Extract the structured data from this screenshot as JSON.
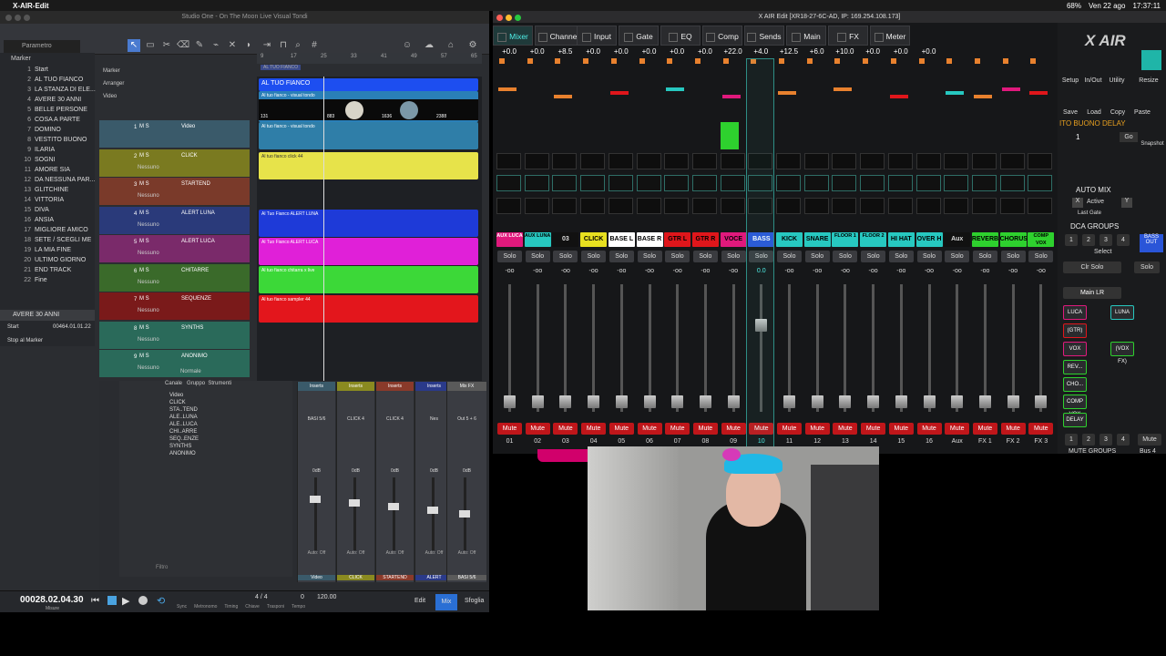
{
  "menubar": {
    "app": "X-AIR-Edit",
    "date": "Ven 22 ago",
    "time": "17:37:11",
    "battery": "68%"
  },
  "studio": {
    "title": "Studio One - On The Moon Live Visual Tondi",
    "param_label": "Parametro",
    "markers_header": "Marker",
    "markers": [
      {
        "n": "1",
        "name": "Start"
      },
      {
        "n": "2",
        "name": "AL TUO FIANCO"
      },
      {
        "n": "3",
        "name": "LA STANZA DI ELE..."
      },
      {
        "n": "4",
        "name": "AVERE 30 ANNI"
      },
      {
        "n": "5",
        "name": "BELLE PERSONE"
      },
      {
        "n": "6",
        "name": "COSA A PARTE"
      },
      {
        "n": "7",
        "name": "DOMINO"
      },
      {
        "n": "8",
        "name": "VESTITO BUONO"
      },
      {
        "n": "9",
        "name": "ILARIA"
      },
      {
        "n": "10",
        "name": "SOGNI"
      },
      {
        "n": "11",
        "name": "AMORE SIA"
      },
      {
        "n": "12",
        "name": "DA NESSUNA PAR..."
      },
      {
        "n": "13",
        "name": "GLITCHINE"
      },
      {
        "n": "14",
        "name": "VITTORIA"
      },
      {
        "n": "15",
        "name": "DIVA"
      },
      {
        "n": "16",
        "name": "ANSIA"
      },
      {
        "n": "17",
        "name": "MIGLIORE AMICO"
      },
      {
        "n": "18",
        "name": "SETE / SCEGLI ME"
      },
      {
        "n": "19",
        "name": "LA MIA FINE"
      },
      {
        "n": "20",
        "name": "ULTIMO GIORNO"
      },
      {
        "n": "21",
        "name": "END TRACK"
      },
      {
        "n": "22",
        "name": "Fine"
      }
    ],
    "marker_current": "AVERE 30 ANNI",
    "marker_start": "Start",
    "marker_start_time": "00464.01.01.22",
    "stop_at_marker": "Stop al Marker",
    "arranger_label": "Arranger",
    "video_label": "Video",
    "marker_row_label": "Marker",
    "ruler_marks": [
      "9",
      "17",
      "25",
      "33",
      "41",
      "49",
      "57",
      "65"
    ],
    "ruler_marker_tag": "AL TUO FIANCO",
    "tracks": [
      {
        "num": "1",
        "name": "Video",
        "sub": "",
        "color": "#3a5a6a"
      },
      {
        "num": "2",
        "name": "CLICK",
        "sub": "Nessuno",
        "color": "#7a7a20"
      },
      {
        "num": "3",
        "name": "STARTEND",
        "sub": "Nessuno",
        "color": "#7a3a2a"
      },
      {
        "num": "4",
        "name": "ALERT LUNA",
        "sub": "Nessuno",
        "color": "#2a3a7a"
      },
      {
        "num": "5",
        "name": "ALERT LUCA",
        "sub": "Nessuno",
        "color": "#7a2a6a"
      },
      {
        "num": "6",
        "name": "CHITARRE",
        "sub": "Nessuno",
        "color": "#3a6a2a"
      },
      {
        "num": "7",
        "name": "SEQUENZE",
        "sub": "Nessuno",
        "color": "#7a1a1a"
      },
      {
        "num": "8",
        "name": "SYNTHS",
        "sub": "Nessuno",
        "color": "#2a6a5a"
      },
      {
        "num": "9",
        "name": "ANONIMO",
        "sub": "Nessuno",
        "color": "#2a6a5a"
      }
    ],
    "clips": {
      "arranger": "AL TUO FIANCO",
      "video": "Al tuo fianco - visual tondo",
      "video_frames": [
        "131",
        "883",
        "1636",
        "2388"
      ],
      "video_audio": "Al tuo fianco - visual tondo",
      "click": "Al tuo fianco click 44",
      "luna": "Al Tuo Fianco ALERT LUNA",
      "luca": "Al Tuo Fianco ALERT LUCA",
      "chitarre": "Al tuo fianco chitarra x live",
      "sequenze": "Al tuo fianco sampler 44"
    },
    "normal_label": "Normale",
    "console": {
      "tabs": [
        "Canale",
        "Gruppo",
        "Strumenti"
      ],
      "channels": [
        "Video",
        "CLICK",
        "STA..TEND",
        "ALE..LUNA",
        "ALE..LUCA",
        "CHI..ARRE",
        "SEQ..ENZE",
        "SYNTHS",
        "ANONIMO"
      ],
      "filter": "Filtro",
      "inserts_label": "Inserts",
      "strips": [
        {
          "label": "Video",
          "in": "BASI 5/6",
          "num": "1"
        },
        {
          "label": "CLICK",
          "in": "CLICK 4",
          "num": "2"
        },
        {
          "label": "STARTEND",
          "in": "CLICK 4",
          "num": "3"
        },
        {
          "label": "ALERT",
          "in": "Nes",
          "num": "4"
        },
        {
          "label": "BASI 5/6",
          "in": "Out 5 + 6",
          "num": ""
        }
      ],
      "mix_fx": "Mix FX",
      "stereo": "Stereo",
      "nessuno": "Nessuno",
      "auto_off": "Auto: Off",
      "db_label": "0dB"
    },
    "transport": {
      "time": "00028.02.04.30",
      "time_unit": "Misure",
      "sig": "4 / 4",
      "key": "0",
      "tempo": "120.00",
      "labels": [
        "Sync",
        "Metronomo",
        "Timing",
        "Chiave",
        "Trasponi",
        "Tempo"
      ],
      "edit": "Edit",
      "mix": "Mix",
      "browse": "Sfoglia"
    }
  },
  "xair": {
    "title": "X AIR Edit [XR18-27-6C-AD, IP: 169.254.108.173]",
    "tabs": [
      "Mixer",
      "Channel",
      "Input",
      "Gate",
      "EQ",
      "Comp",
      "Sends",
      "Main",
      "FX",
      "Meter"
    ],
    "active_tab": "Mixer",
    "logo": "X AIR",
    "gains": [
      "+0.0",
      "+0.0",
      "+8.5",
      "+0.0",
      "+0.0",
      "+0.0",
      "+0.0",
      "+0.0",
      "+22.0",
      "+4.0",
      "+12.5",
      "+6.0",
      "+10.0",
      "+0.0",
      "+0.0",
      "+0.0"
    ],
    "channels": [
      {
        "name": "AUX LUCA",
        "color": "#e0197c",
        "fcolor": "#fff",
        "num": "01"
      },
      {
        "name": "AUX LUNA",
        "color": "#27c8c0",
        "fcolor": "#000",
        "num": "02"
      },
      {
        "name": "03",
        "color": "#111",
        "fcolor": "#ddd",
        "num": "03"
      },
      {
        "name": "CLICK",
        "color": "#e8e020",
        "fcolor": "#000",
        "num": "04"
      },
      {
        "name": "BASE L",
        "color": "#ffffff",
        "fcolor": "#000",
        "num": "05"
      },
      {
        "name": "BASE R",
        "color": "#ffffff",
        "fcolor": "#000",
        "num": "06"
      },
      {
        "name": "GTR L",
        "color": "#e0161b",
        "fcolor": "#000",
        "num": "07"
      },
      {
        "name": "GTR R",
        "color": "#e0161b",
        "fcolor": "#000",
        "num": "08"
      },
      {
        "name": "VOCE",
        "color": "#e0197c",
        "fcolor": "#000",
        "num": "09"
      },
      {
        "name": "BASS",
        "color": "#2a55d8",
        "fcolor": "#fff",
        "num": "10"
      },
      {
        "name": "KICK",
        "color": "#27c8c0",
        "fcolor": "#000",
        "num": "11"
      },
      {
        "name": "SNARE",
        "color": "#27c8c0",
        "fcolor": "#000",
        "num": "12"
      },
      {
        "name": "FLOOR 1",
        "color": "#27c8c0",
        "fcolor": "#000",
        "num": "13"
      },
      {
        "name": "FLOOR 2",
        "color": "#27c8c0",
        "fcolor": "#000",
        "num": "14"
      },
      {
        "name": "HI HAT",
        "color": "#27c8c0",
        "fcolor": "#000",
        "num": "15"
      },
      {
        "name": "OVER H",
        "color": "#27c8c0",
        "fcolor": "#000",
        "num": "16"
      },
      {
        "name": "Aux",
        "color": "#111",
        "fcolor": "#ddd",
        "num": "Aux"
      },
      {
        "name": "REVERB",
        "color": "#2ed12e",
        "fcolor": "#000",
        "num": "FX 1"
      },
      {
        "name": "CHORUS",
        "color": "#2ed12e",
        "fcolor": "#000",
        "num": "FX 2"
      },
      {
        "name": "COMP VOX",
        "color": "#2ed12e",
        "fcolor": "#000",
        "num": "FX 3"
      }
    ],
    "solo_label": "Solo",
    "mute_label": "Mute",
    "db_inf": "-oo",
    "bass_db": "0.0",
    "right": {
      "setup": "Setup",
      "inout": "In/Out",
      "utility": "Utility",
      "resize": "Resize",
      "save": "Save",
      "load": "Load",
      "copy": "Copy",
      "paste": "Paste",
      "scene": "ITO BUONO DELAY",
      "scene_num": "1",
      "go": "Go",
      "snapshot": "Snapshot",
      "automix": "AUTO MIX",
      "active": "Active",
      "last_gate": "Last Gate",
      "dca_groups": "DCA GROUPS",
      "dca": [
        "1",
        "2",
        "3",
        "4"
      ],
      "select": "Select",
      "clr_solo": "Clr Solo",
      "solo": "Solo",
      "main_lr": "Main LR",
      "sel_buttons": [
        "LUCA",
        "LUNA",
        "(GTR)",
        "BASS OUT",
        "VOX",
        "(VOX FX)",
        "REV...",
        "CHO...",
        "COMP VOX",
        "DELAY"
      ],
      "bass_out": "BASS OUT",
      "mute_groups": "MUTE GROUPS",
      "mute": "Mute",
      "bus4": "Bus 4"
    }
  }
}
